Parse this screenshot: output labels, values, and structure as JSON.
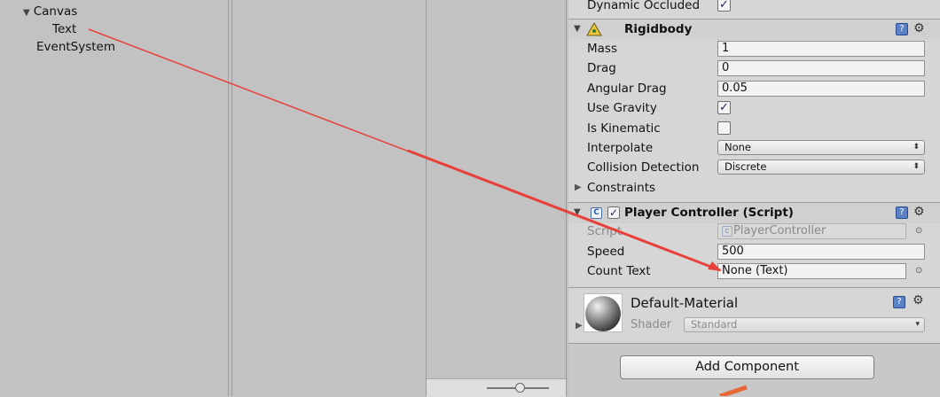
{
  "hierarchy": {
    "items": [
      {
        "label": "Canvas"
      },
      {
        "label": "Text"
      },
      {
        "label": "EventSystem"
      }
    ]
  },
  "inspector": {
    "renderer": {
      "dynamic_occluded_label": "Dynamic Occluded",
      "dynamic_occluded": true
    },
    "rigidbody": {
      "title": "Rigidbody",
      "mass_label": "Mass",
      "mass": "1",
      "drag_label": "Drag",
      "drag": "0",
      "angular_drag_label": "Angular Drag",
      "angular_drag": "0.05",
      "use_gravity_label": "Use Gravity",
      "use_gravity": true,
      "is_kinematic_label": "Is Kinematic",
      "is_kinematic": false,
      "interpolate_label": "Interpolate",
      "interpolate": "None",
      "collision_detection_label": "Collision Detection",
      "collision_detection": "Discrete",
      "constraints_label": "Constraints"
    },
    "player_controller": {
      "title": "Player Controller (Script)",
      "script_label": "Script",
      "script": "PlayerController",
      "speed_label": "Speed",
      "speed": "500",
      "count_text_label": "Count Text",
      "count_text": "None (Text)"
    },
    "material": {
      "name": "Default-Material",
      "shader_label": "Shader",
      "shader": "Standard"
    },
    "add_component_label": "Add Component"
  },
  "colors": {
    "annotation_arrow": "#e8403a",
    "annotation_arrow_secondary": "#e86a3a"
  }
}
